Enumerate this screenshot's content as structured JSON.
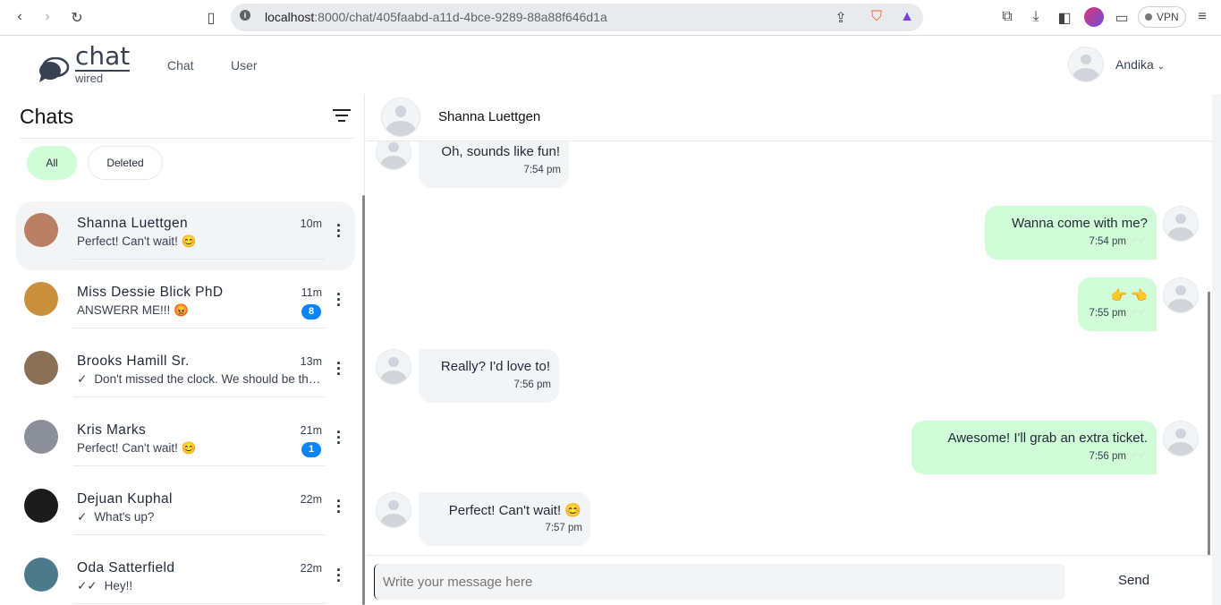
{
  "browser": {
    "url_host": "localhost",
    "url_path": ":8000/chat/405faabd-a11d-4bce-9289-88a88f646d1a",
    "vpn": "VPN"
  },
  "header": {
    "logo_main": "chat",
    "logo_sub": "wired",
    "nav": [
      "Chat",
      "User"
    ],
    "user": "Andika"
  },
  "sidebar": {
    "title": "Chats",
    "filters": [
      "All",
      "Deleted"
    ],
    "chats": [
      {
        "name": "Shanna Luettgen",
        "time": "10m",
        "last": "Perfect! Can't wait! 😊",
        "badge": null,
        "check": "",
        "color": "#b98066"
      },
      {
        "name": "Miss Dessie Blick PhD",
        "time": "11m",
        "last": "ANSWERR ME!!! 😡",
        "badge": "8",
        "check": "",
        "color": "#c8903a"
      },
      {
        "name": "Brooks Hamill Sr.",
        "time": "13m",
        "last": "Don't missed the clock. We should be there on time",
        "badge": null,
        "check": "✓",
        "color": "#8a7056"
      },
      {
        "name": "Kris Marks",
        "time": "21m",
        "last": "Perfect! Can't wait! 😊",
        "badge": "1",
        "check": "",
        "color": "#8b8f99"
      },
      {
        "name": "Dejuan Kuphal",
        "time": "22m",
        "last": "What's up?",
        "badge": null,
        "check": "✓",
        "color": "#1b1b1b"
      },
      {
        "name": "Oda Satterfield",
        "time": "22m",
        "last": "Hey!!",
        "badge": null,
        "check": "✓✓",
        "color": "#4d7a8a"
      }
    ]
  },
  "chat": {
    "contact": "Shanna Luettgen",
    "messages": [
      {
        "side": "in",
        "text": "Oh, sounds like fun!",
        "time": "7:54 pm"
      },
      {
        "side": "out",
        "text": "Wanna come with me?",
        "time": "7:54 pm"
      },
      {
        "side": "out",
        "text": "👉 👈",
        "time": "7:55 pm"
      },
      {
        "side": "in",
        "text": "Really? I'd love to!",
        "time": "7:56 pm"
      },
      {
        "side": "out",
        "text": "Awesome! I'll grab an extra ticket.",
        "time": "7:56 pm"
      },
      {
        "side": "in",
        "text": "Perfect! Can't wait! 😊",
        "time": "7:57 pm"
      }
    ],
    "input_placeholder": "Write your message here",
    "send": "Send"
  }
}
